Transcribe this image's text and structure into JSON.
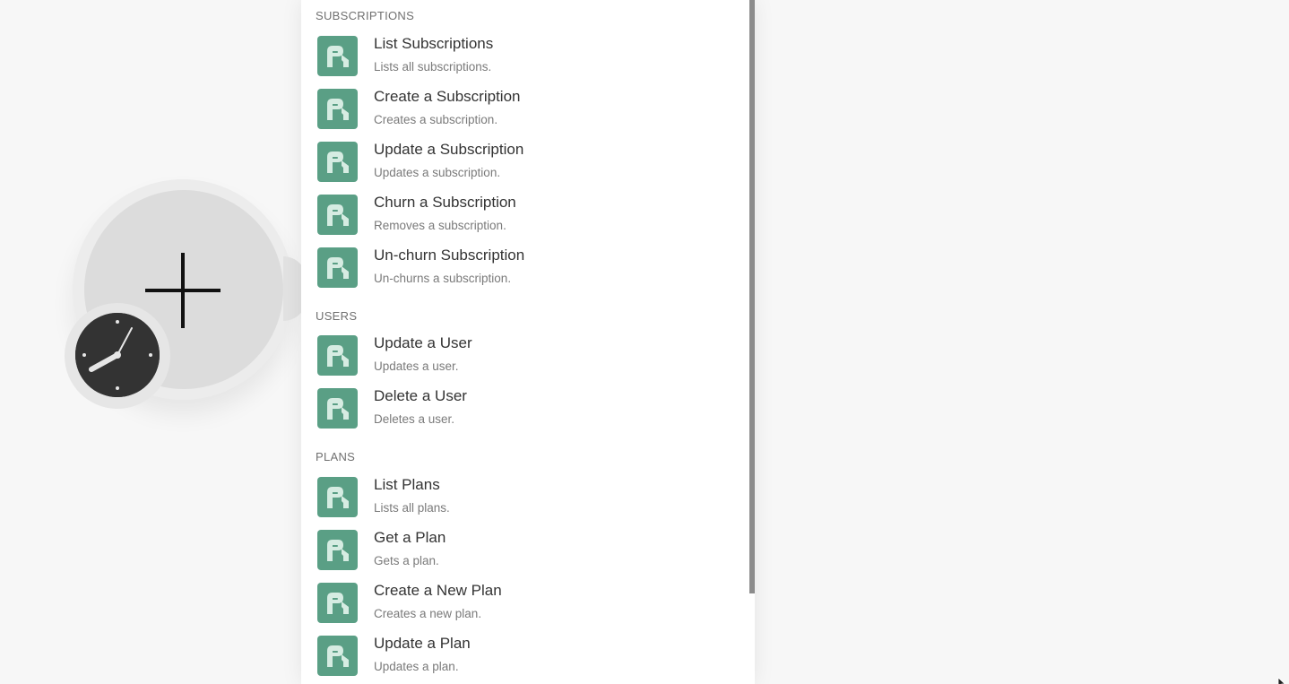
{
  "module": {
    "plus_icon": "plus-icon",
    "trigger_icon": "clock-icon"
  },
  "panel": {
    "sections": [
      {
        "header": "SUBSCRIPTIONS",
        "items": [
          {
            "title": "List Subscriptions",
            "desc": "Lists all subscriptions."
          },
          {
            "title": "Create a Subscription",
            "desc": "Creates a subscription."
          },
          {
            "title": "Update a Subscription",
            "desc": "Updates a subscription."
          },
          {
            "title": "Churn a Subscription",
            "desc": "Removes a subscription."
          },
          {
            "title": "Un-churn Subscription",
            "desc": "Un-churns a subscription."
          }
        ]
      },
      {
        "header": "USERS",
        "items": [
          {
            "title": "Update a User",
            "desc": "Updates a user."
          },
          {
            "title": "Delete a User",
            "desc": "Deletes a user."
          }
        ]
      },
      {
        "header": "PLANS",
        "items": [
          {
            "title": "List Plans",
            "desc": "Lists all plans."
          },
          {
            "title": "Get a Plan",
            "desc": "Gets a plan."
          },
          {
            "title": "Create a New Plan",
            "desc": "Creates a new plan."
          },
          {
            "title": "Update a Plan",
            "desc": "Updates a plan."
          }
        ]
      }
    ]
  },
  "colors": {
    "app_icon": "#5a9f85",
    "background": "#f7f7f7"
  }
}
